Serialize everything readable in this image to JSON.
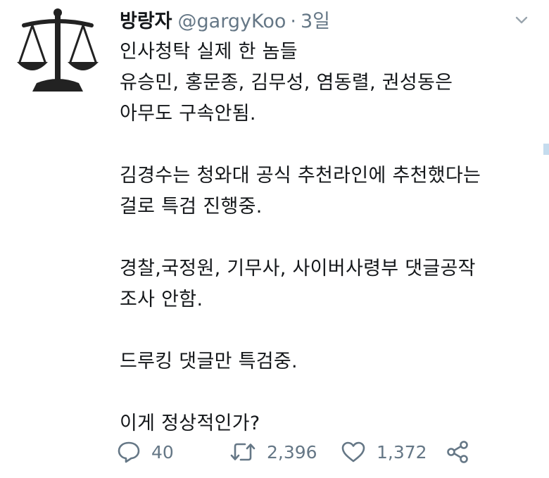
{
  "tweet": {
    "author_name": "방랑자",
    "handle": "@gargyKoo",
    "separator": "·",
    "time": "3일",
    "body_lines": [
      "인사청탁 실제 한 놈들",
      "유승민, 홍문종, 김무성, 염동렬, 권성동은",
      "아무도 구속안됨.",
      "",
      "김경수는 청와대 공식 추천라인에 추천했다는",
      "걸로 특검 진행중.",
      "",
      "경찰,국정원, 기무사, 사이버사령부 댓글공작",
      "조사 안함.",
      "",
      "드루킹 댓글만 특검중.",
      "",
      "이게 정상적인가?"
    ],
    "counts": {
      "replies": "40",
      "retweets": "2,396",
      "likes": "1,372"
    }
  },
  "icons": {
    "avatar": "scales-of-justice-icon",
    "menu": "chevron-down-icon",
    "reply": "speech-bubble-icon",
    "retweet": "retweet-icon",
    "like": "heart-icon",
    "share": "share-icon"
  },
  "colors": {
    "text": "#14171a",
    "secondary": "#657786",
    "avatar": "#222222"
  }
}
